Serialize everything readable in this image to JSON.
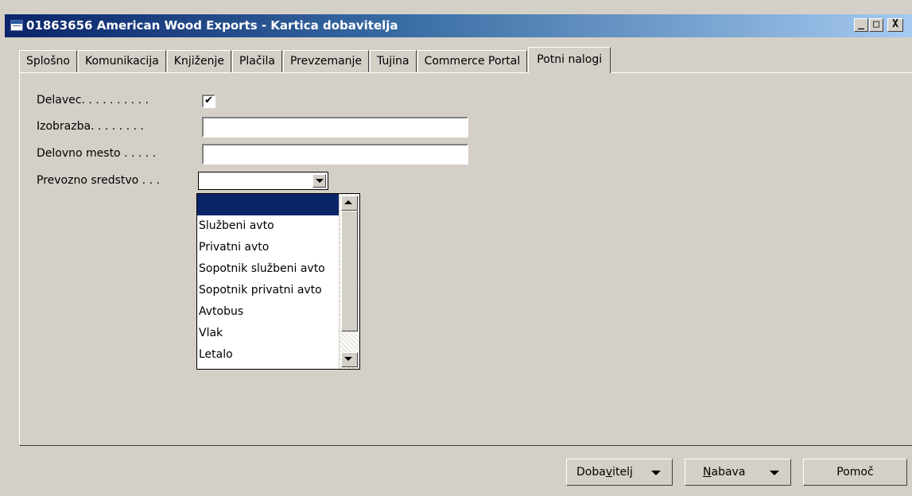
{
  "window": {
    "title": "01863656 American Wood Exports - Kartica dobavitelja",
    "icon": "table-icon",
    "controls": {
      "minimize": "_",
      "maximize": "□",
      "close": "X"
    }
  },
  "tabs": [
    {
      "label": "Splošno"
    },
    {
      "label": "Komunikacija"
    },
    {
      "label": "Knjiženje"
    },
    {
      "label": "Plačila"
    },
    {
      "label": "Prevzemanje"
    },
    {
      "label": "Tujina"
    },
    {
      "label": "Commerce Portal"
    },
    {
      "label": "Potni nalogi",
      "active": true
    }
  ],
  "fields": {
    "delavec": {
      "label": "Delavec. . . . . . . . . .",
      "checked": true,
      "check_glyph": "✔"
    },
    "izobrazba": {
      "label": "Izobrazba. . . . . . . .",
      "value": ""
    },
    "delovno_mesto": {
      "label": "Delovno mesto . . . . .",
      "value": ""
    },
    "prevozno_sredstvo": {
      "label": "Prevozno sredstvo . . .",
      "value": ""
    }
  },
  "dropdown": {
    "options": [
      "",
      "Službeni avto",
      "Privatni avto",
      "Sopotnik službeni avto",
      "Sopotnik privatni avto",
      "Avtobus",
      "Vlak",
      "Letalo"
    ],
    "selected_index": 0
  },
  "buttons": {
    "dobavitelj": {
      "pre": "Doba",
      "mnemonic": "v",
      "post": "itelj"
    },
    "nabava": {
      "pre": "",
      "mnemonic": "N",
      "post": "abava"
    },
    "pomoc": {
      "label": "Pomoč"
    }
  }
}
